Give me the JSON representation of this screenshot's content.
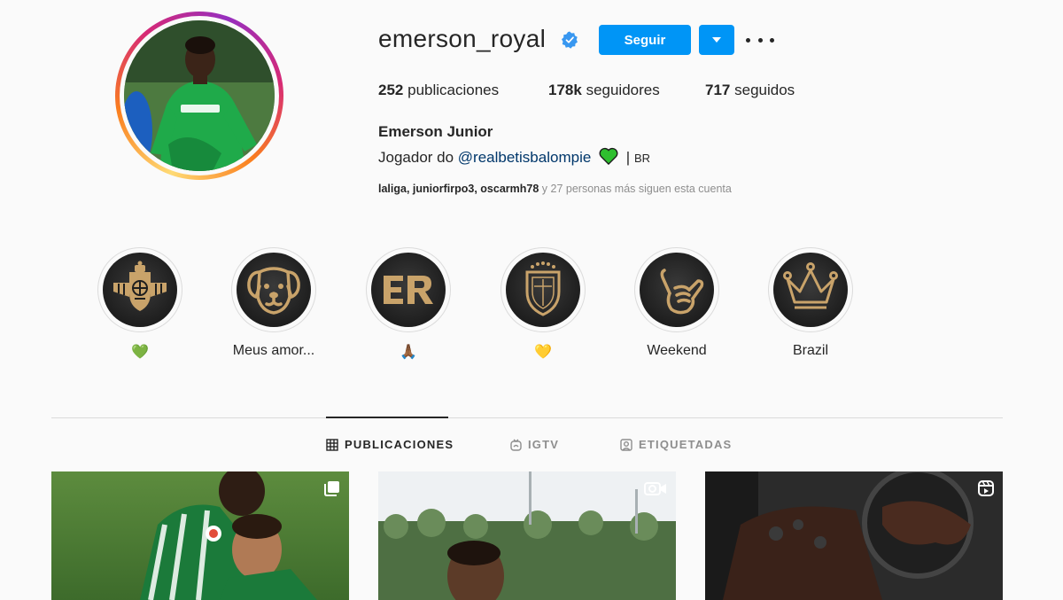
{
  "profile": {
    "username": "emerson_royal",
    "verified": true,
    "follow_label": "Seguir",
    "stats": {
      "posts_count": "252",
      "posts_label": "publicaciones",
      "followers_count": "178k",
      "followers_label": "seguidores",
      "following_count": "717",
      "following_label": "seguidos"
    },
    "full_name": "Emerson Junior",
    "bio": {
      "prefix": "Jogador do ",
      "mention": "@realbetisbalompie",
      "separator": "|",
      "flag": "BR"
    },
    "followed_by": {
      "names": "laliga, juniorfirpo3, oscarmh78",
      "suffix": "y 27 personas más siguen esta cuenta"
    }
  },
  "highlights": [
    {
      "label": "💚",
      "icon": "betis-crest-icon"
    },
    {
      "label": "Meus amor...",
      "icon": "dog-icon"
    },
    {
      "label": "🙏🏾",
      "icon": "er-monogram-icon"
    },
    {
      "label": "💛",
      "icon": "cbf-crest-icon"
    },
    {
      "label": "Weekend",
      "icon": "shaka-hand-icon"
    },
    {
      "label": "Brazil",
      "icon": "crown-icon"
    }
  ],
  "tabs": [
    {
      "label": "PUBLICACIONES",
      "icon": "grid-icon",
      "active": true
    },
    {
      "label": "IGTV",
      "icon": "igtv-icon",
      "active": false
    },
    {
      "label": "ETIQUETADAS",
      "icon": "tagged-icon",
      "active": false
    }
  ],
  "posts": [
    {
      "type": "carousel",
      "badge_icon": "carousel-icon"
    },
    {
      "type": "igtv",
      "badge_icon": "igtv-badge-icon"
    },
    {
      "type": "reel",
      "badge_icon": "reel-icon"
    }
  ],
  "colors": {
    "primary_button": "#0095f6",
    "mention_link": "#00376b",
    "muted_text": "#8e8e8e",
    "highlight_gold": "#c9a36a"
  }
}
